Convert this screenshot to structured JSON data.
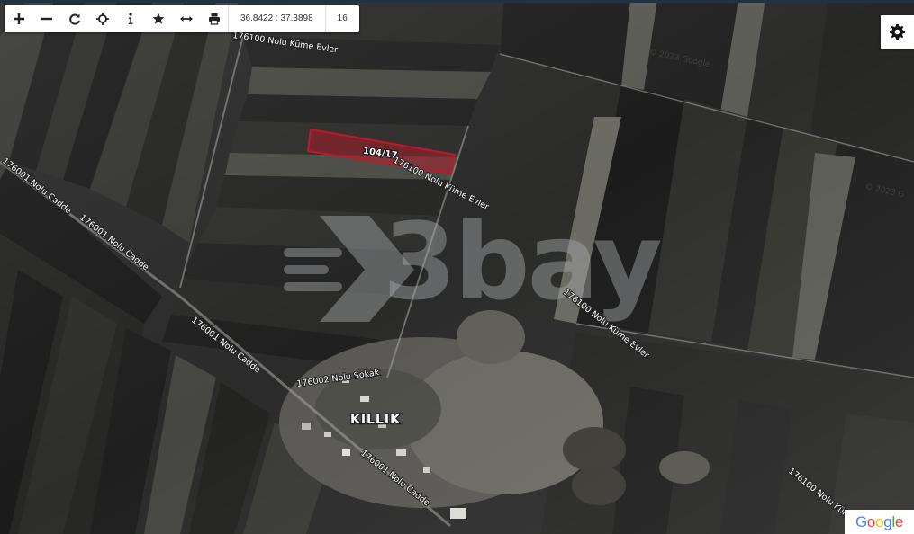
{
  "toolbar": {
    "tools": [
      {
        "name": "zoom-in-icon"
      },
      {
        "name": "zoom-out-icon"
      },
      {
        "name": "refresh-icon"
      },
      {
        "name": "locate-icon"
      },
      {
        "name": "info-icon"
      },
      {
        "name": "star-icon"
      },
      {
        "name": "measure-icon"
      },
      {
        "name": "print-icon"
      }
    ],
    "coordinates": "36.8422 : 37.3898",
    "zoom_level": "16"
  },
  "settings": {
    "icon": "gear-icon"
  },
  "map": {
    "parcel_label": "104/17",
    "village_label": "KILLIK",
    "roads": {
      "cadde_upper": "176001 Nolu Cadde",
      "cadde_middle": "176001 Nolu Cadde",
      "cadde_lower": "176001 Nolu Cadde",
      "kume_evler_top": "176100 Nolu Küme Evler",
      "kume_evler_parcel": "176100 Nolu Küme Evler",
      "kume_evler_middle": "176100 Nolu Küme Evler",
      "kume_evler_right": "176100 Nolu Küme Evler",
      "sokak": "176002 Nolu Sokak"
    },
    "watermark": "3bay",
    "parcel_color": "#c0182a"
  },
  "attribution": {
    "google_logo": "Google"
  }
}
